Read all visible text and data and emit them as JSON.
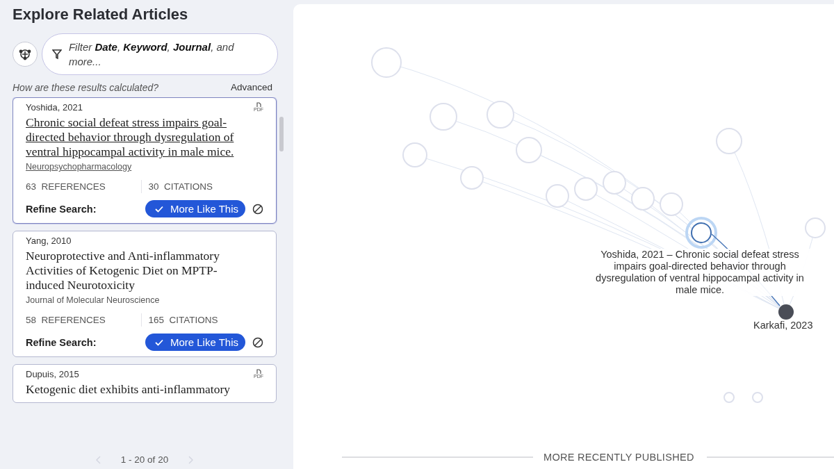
{
  "sidebar": {
    "title": "Explore Related Articles",
    "filter": {
      "placeholder": "Filter **Date**, **Keyword**, **Journal**, and more..."
    },
    "help_link": "How are these results calculated?",
    "advanced": "Advanced",
    "articles": [
      {
        "author_year": "Yoshida, 2021",
        "pdf": "PDF",
        "title": "Chronic social defeat stress impairs goal-directed behavior through dysregulation of ventral hippocampal activity in male mice.",
        "journal": "Neuropsychopharmacology",
        "references": "63",
        "references_label": "REFERENCES",
        "citations": "30",
        "citations_label": "CITATIONS",
        "refine_label": "Refine Search:",
        "more_button": "More Like This",
        "selected": true
      },
      {
        "author_year": "Yang, 2010",
        "title": "Neuroprotective and Anti-inflammatory Activities of Ketogenic Diet on MPTP-induced Neurotoxicity",
        "journal": "Journal of Molecular Neuroscience",
        "references": "58",
        "references_label": "REFERENCES",
        "citations": "165",
        "citations_label": "CITATIONS",
        "refine_label": "Refine Search:",
        "more_button": "More Like This",
        "selected": false
      },
      {
        "author_year": "Dupuis, 2015",
        "pdf": "PDF",
        "title": "Ketogenic diet exhibits anti-inflammatory",
        "selected": false
      }
    ],
    "pagination": "1 - 20 of 20"
  },
  "graph": {
    "focus_label": "Yoshida, 2021 – Chronic social defeat stress impairs goal-directed behavior through dysregulation of ventral hippocampal activity in male mice.",
    "origin_label": "Karkafi, 2023",
    "axis_label": "MORE RECENTLY PUBLISHED"
  }
}
